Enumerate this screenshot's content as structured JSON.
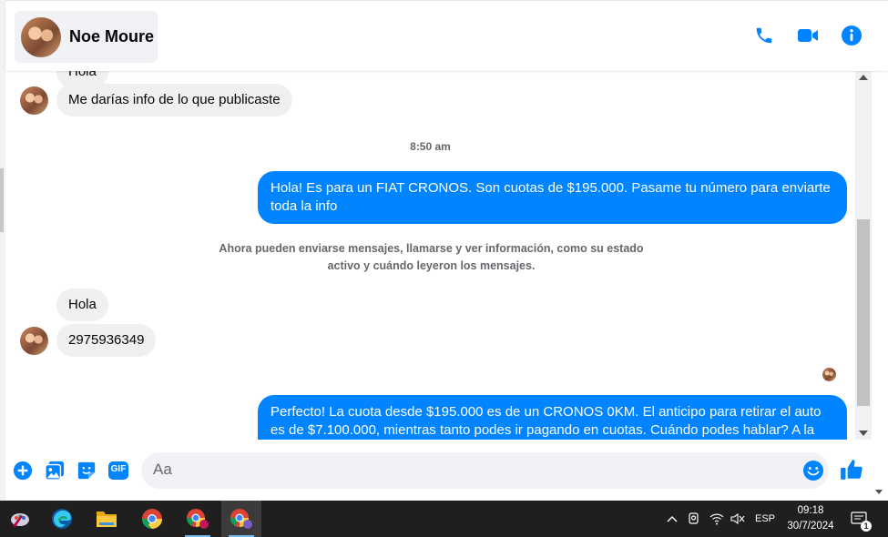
{
  "header": {
    "contact_name": "Noe Moure"
  },
  "messages": {
    "partial_top": "Hola",
    "incoming_1": "Me darías info de lo que publicaste",
    "timestamp": "8:50 am",
    "outgoing_1": "Hola! Es para un FIAT CRONOS. Son cuotas de $195.000. Pasame tu número para enviarte toda la info",
    "system_notice": "Ahora pueden enviarse mensajes, llamarse y ver información, como su estado activo y cuándo leyeron los mensajes.",
    "incoming_2": "Hola",
    "incoming_3": "2975936349",
    "outgoing_2": "Perfecto! La cuota desde $195.000 es de un CRONOS 0KM. El anticipo para retirar el auto es de $7.100.000, mientras tanto podes ir pagando en cuotas. Cuándo podes hablar? A la"
  },
  "composer": {
    "placeholder": "Aa",
    "gif_label": "GIF"
  },
  "taskbar": {
    "language": "ESP",
    "time": "09:18",
    "date": "30/7/2024",
    "notification_count": "1"
  },
  "colors": {
    "accent": "#0084ff",
    "incoming_bubble": "#f0f0f0",
    "taskbar": "#1f1f1f"
  }
}
